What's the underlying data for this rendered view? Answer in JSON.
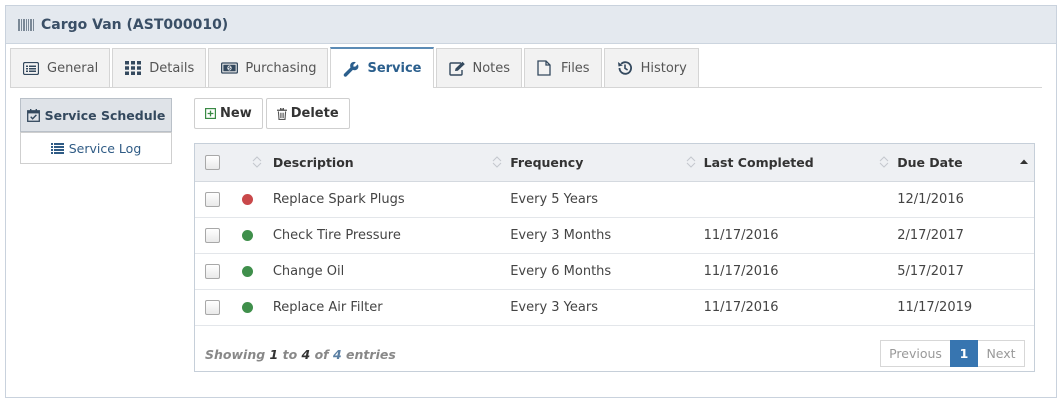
{
  "header": {
    "title": "Cargo Van (AST000010)",
    "icon": "barcode-icon"
  },
  "tabs": [
    {
      "label": "General",
      "icon": "list-alt-icon"
    },
    {
      "label": "Details",
      "icon": "grid-icon"
    },
    {
      "label": "Purchasing",
      "icon": "money-icon"
    },
    {
      "label": "Service",
      "icon": "wrench-icon",
      "active": true
    },
    {
      "label": "Notes",
      "icon": "edit-icon"
    },
    {
      "label": "Files",
      "icon": "file-icon"
    },
    {
      "label": "History",
      "icon": "history-icon"
    }
  ],
  "side_nav": [
    {
      "label": "Service Schedule",
      "icon": "calendar-check-icon",
      "active": true
    },
    {
      "label": "Service Log",
      "icon": "list-icon"
    }
  ],
  "toolbar": {
    "new_label": "New",
    "delete_label": "Delete"
  },
  "table": {
    "columns": [
      "Description",
      "Frequency",
      "Last Completed",
      "Due Date"
    ],
    "rows": [
      {
        "status_color": "#c9484a",
        "description": "Replace Spark Plugs",
        "frequency": "Every 5 Years",
        "last_completed": "",
        "due_date": "12/1/2016"
      },
      {
        "status_color": "#3f8f4b",
        "description": "Check Tire Pressure",
        "frequency": "Every 3 Months",
        "last_completed": "11/17/2016",
        "due_date": "2/17/2017"
      },
      {
        "status_color": "#3f8f4b",
        "description": "Change Oil",
        "frequency": "Every 6 Months",
        "last_completed": "11/17/2016",
        "due_date": "5/17/2017"
      },
      {
        "status_color": "#3f8f4b",
        "description": "Replace Air Filter",
        "frequency": "Every 3 Years",
        "last_completed": "11/17/2016",
        "due_date": "11/17/2019"
      }
    ]
  },
  "footer": {
    "showing_prefix": "Showing",
    "from": "1",
    "to_word": "to",
    "to": "4",
    "of_word": "of",
    "total": "4",
    "suffix": "entries"
  },
  "pagination": {
    "previous": "Previous",
    "current": "1",
    "next": "Next"
  },
  "colors": {
    "accent": "#3775b0",
    "header_bg": "#e4e9ef"
  }
}
